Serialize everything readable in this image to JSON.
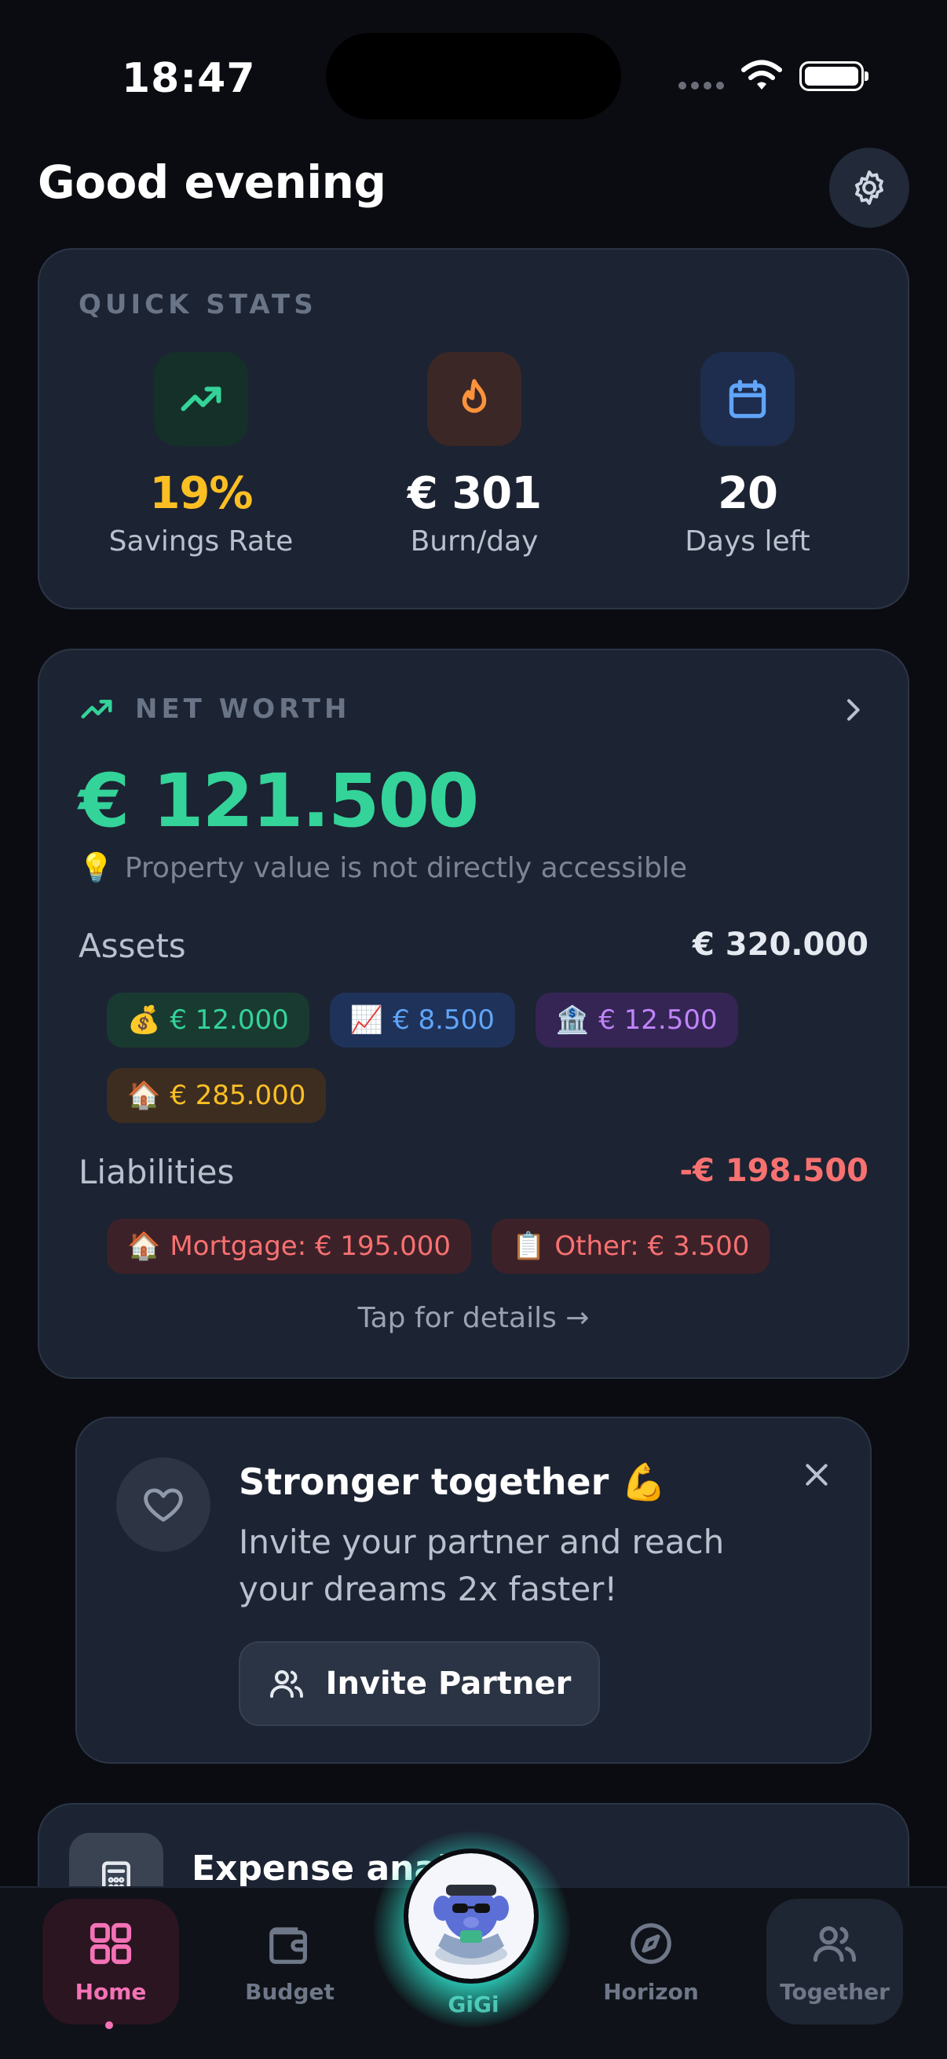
{
  "status_bar": {
    "time": "18:47"
  },
  "header": {
    "greeting": "Good evening"
  },
  "quick_stats": {
    "title": "QUICK STATS",
    "items": [
      {
        "icon": "trending-up-icon",
        "value": "19%",
        "label": "Savings Rate",
        "color": "#fbbf24"
      },
      {
        "icon": "flame-icon",
        "value": "€ 301",
        "label": "Burn/day",
        "color": "#ffffff"
      },
      {
        "icon": "calendar-icon",
        "value": "20",
        "label": "Days left",
        "color": "#ffffff"
      }
    ]
  },
  "net_worth": {
    "title": "NET WORTH",
    "value": "€ 121.500",
    "note": "Property value is not directly accessible",
    "assets": {
      "label": "Assets",
      "total": "€ 320.000",
      "chips": [
        {
          "emoji": "💰",
          "amount": "€ 12.000"
        },
        {
          "emoji": "📈",
          "amount": "€ 8.500"
        },
        {
          "emoji": "🏦",
          "amount": "€ 12.500"
        },
        {
          "emoji": "🏠",
          "amount": "€ 285.000"
        }
      ]
    },
    "liabilities": {
      "label": "Liabilities",
      "total": "-€ 198.500",
      "chips": [
        {
          "emoji": "🏠",
          "text": "Mortgage: € 195.000"
        },
        {
          "emoji": "📋",
          "text": "Other: € 3.500"
        }
      ]
    },
    "details_link": "Tap for details →"
  },
  "invite": {
    "title": "Stronger together 💪",
    "text": "Invite your partner and reach your dreams 2x faster!",
    "button": "Invite Partner"
  },
  "expense_card": {
    "title": "Expense analy"
  },
  "tabbar": {
    "home": "Home",
    "budget": "Budget",
    "gigi": "GiGi",
    "horizon": "Horizon",
    "together": "Together"
  },
  "colors": {
    "accent_green": "#34d399",
    "accent_pink": "#f472b6",
    "negative_red": "#f87171",
    "gigi_glow": "#2dd4bf"
  }
}
